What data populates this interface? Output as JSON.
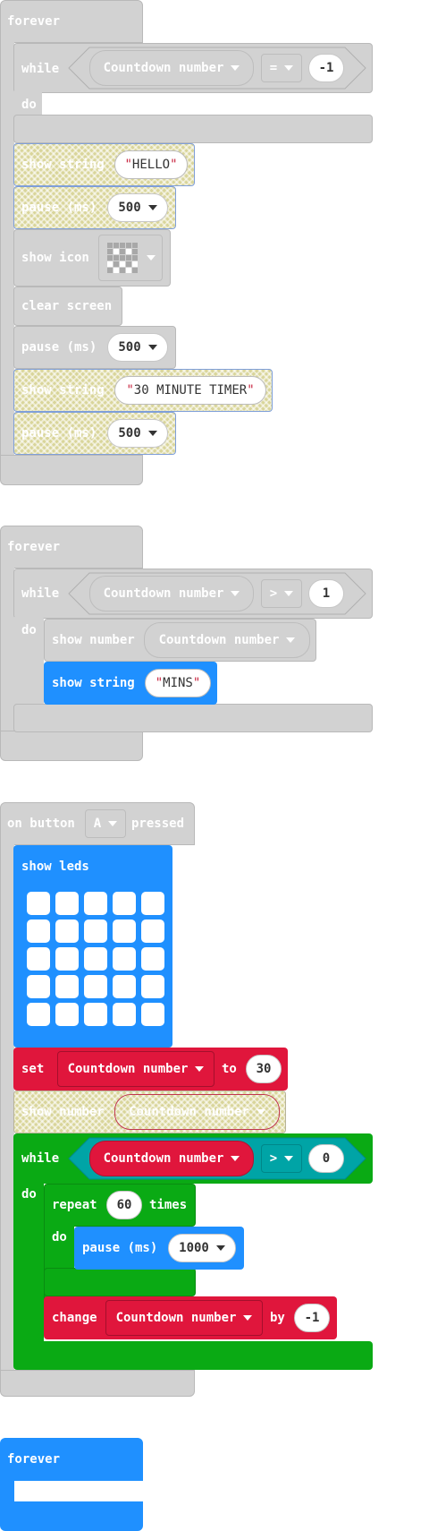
{
  "colors": {
    "grey": "#d2d2d2",
    "blue": "#1f90ff",
    "green": "#0aaa14",
    "red": "#e0163c",
    "teal": "#00a4a6"
  },
  "block1": {
    "hat": "forever",
    "while": "while",
    "do": "do",
    "cond": {
      "variable": "Countdown number",
      "operator": "=",
      "value": "-1"
    },
    "stmts": {
      "s1": {
        "label": "show string",
        "value": "HELLO"
      },
      "p1": {
        "label": "pause (ms)",
        "value": "500"
      },
      "icon": {
        "label": "show icon"
      },
      "clear": {
        "label": "clear screen"
      },
      "p2": {
        "label": "pause (ms)",
        "value": "500"
      },
      "s2": {
        "label": "show string",
        "value": "30 MINUTE TIMER"
      },
      "p3": {
        "label": "pause (ms)",
        "value": "500"
      }
    }
  },
  "block2": {
    "hat": "forever",
    "while": "while",
    "do": "do",
    "cond": {
      "variable": "Countdown number",
      "operator": ">",
      "value": "1"
    },
    "show_number": {
      "label": "show number",
      "variable": "Countdown number"
    },
    "show_string": {
      "label": "show string",
      "value": "MINS"
    }
  },
  "block3": {
    "hat": {
      "on": "on button",
      "button": "A",
      "pressed": "pressed"
    },
    "show_leds": "show leds",
    "set": {
      "set": "set",
      "variable": "Countdown number",
      "to": "to",
      "value": "30"
    },
    "show_number": {
      "label": "show number",
      "variable": "Countdown number"
    },
    "while": {
      "while": "while",
      "do": "do",
      "variable": "Countdown number",
      "operator": ">",
      "value": "0"
    },
    "repeat": {
      "repeat": "repeat",
      "times_value": "60",
      "times": "times",
      "do": "do"
    },
    "pause": {
      "label": "pause (ms)",
      "value": "1000"
    },
    "change": {
      "change": "change",
      "variable": "Countdown number",
      "by": "by",
      "value": "-1"
    }
  },
  "block4": {
    "hat": "forever"
  }
}
